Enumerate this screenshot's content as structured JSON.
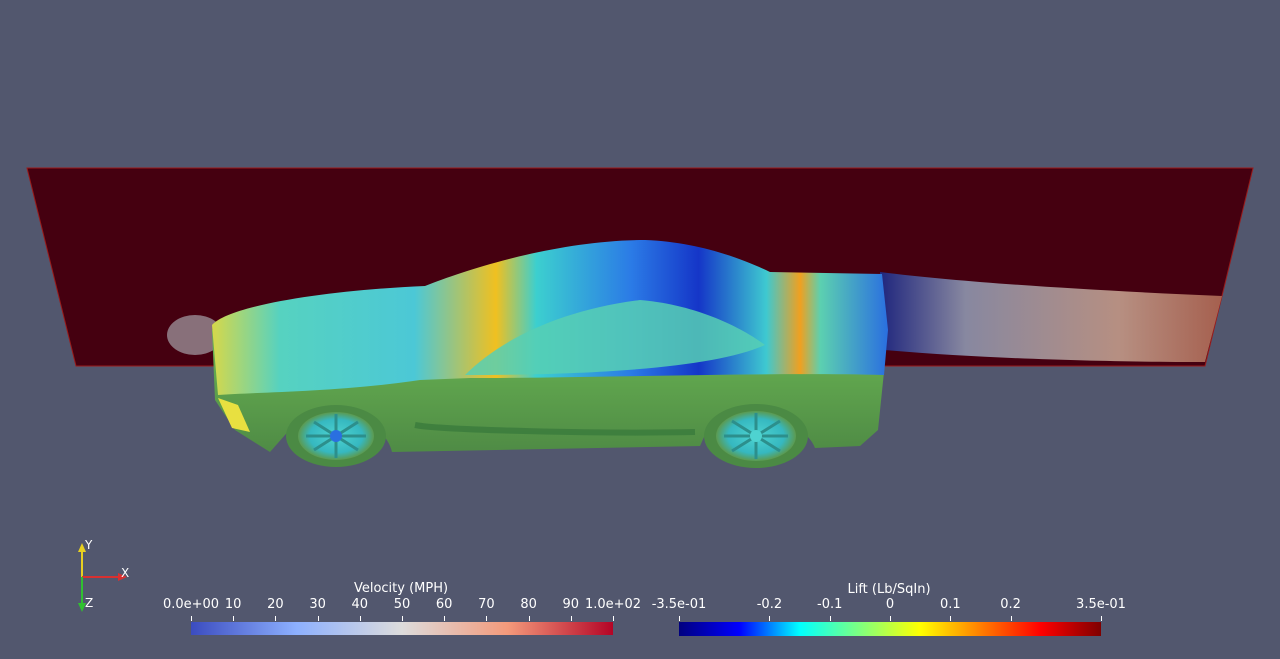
{
  "axes_widget": {
    "x_label": "X",
    "y_label": "Y",
    "z_label": "Z"
  },
  "colorbars": [
    {
      "name": "velocity",
      "title": "Velocity (MPH)",
      "ticks": [
        "0.0e+00",
        "10",
        "20",
        "30",
        "40",
        "50",
        "60",
        "70",
        "80",
        "90",
        "1.0e+02"
      ],
      "range": [
        0,
        100
      ],
      "colors": [
        "#3b4cc0",
        "#8db0fe",
        "#dddcdc",
        "#f49a7b",
        "#b40426"
      ]
    },
    {
      "name": "lift",
      "title": "Lift (Lb/SqIn)",
      "ticks": [
        "-3.5e-01",
        "-0.2",
        "-0.1",
        "0",
        "0.1",
        "0.2",
        "3.5e-01"
      ],
      "tick_values": [
        -0.35,
        -0.2,
        -0.1,
        0,
        0.1,
        0.2,
        0.35
      ],
      "range": [
        -0.35,
        0.35
      ],
      "colors": [
        "#00007f",
        "#0000ff",
        "#00ffff",
        "#7fff7f",
        "#ffff00",
        "#ff7f00",
        "#ff0000",
        "#7f0000"
      ]
    }
  ]
}
